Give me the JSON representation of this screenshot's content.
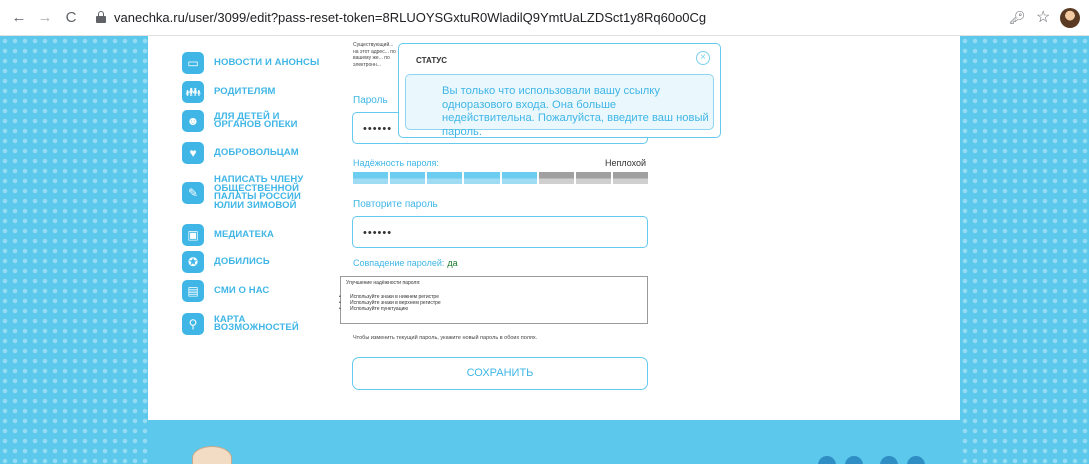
{
  "browser": {
    "url": "vanechka.ru/user/3099/edit?pass-reset-token=8RLUOYSGxtuR0WladilQ9YmtUaLZDSct1y8Rq60o0Cg",
    "icons": [
      "back-arrow-icon",
      "forward-arrow-icon",
      "reload-icon",
      "lock-icon",
      "key-icon",
      "star-icon"
    ]
  },
  "sidebar": {
    "items": [
      {
        "label": "НОВОСТИ И АНОНСЫ",
        "icon": "tv-icon"
      },
      {
        "label": "РОДИТЕЛЯМ",
        "icon": "family-icon"
      },
      {
        "label": "ДЛЯ ДЕТЕЙ И\nОРГАНОВ ОПЕКИ",
        "icon": "children-icon"
      },
      {
        "label": "ДОБРОВОЛЬЦАМ",
        "icon": "heart-icon"
      },
      {
        "label": "НАПИСАТЬ ЧЛЕНУ\nОБЩЕСТВЕННОЙ\nПАЛАТЫ РОССИИ\nЮЛИИ ЗИМОВОЙ",
        "icon": "pen-icon"
      },
      {
        "label": "МЕДИАТЕКА",
        "icon": "media-icon"
      },
      {
        "label": "ДОБИЛИСЬ",
        "icon": "award-icon"
      },
      {
        "label": "СМИ О НАС",
        "icon": "book-icon"
      },
      {
        "label": "КАРТА\nВОЗМОЖНОСТЕЙ",
        "icon": "map-pin-icon"
      }
    ]
  },
  "form": {
    "intro_text": "Существующий... на этот адрес... по вашему же... по электронн...",
    "password_label": "Пароль",
    "password_value": "••••••",
    "strength_label": "Надёжность пароля:",
    "strength_value": "Неплохой",
    "strength_fraction": 0.625,
    "confirm_label": "Повторите пароль",
    "confirm_value": "••••••",
    "match_label": "Совпадение паролей:",
    "match_value": "да",
    "tips_title": "Улучшение надёжности пароля:",
    "tips": [
      "Используйте знаки в нижнем регистре",
      "Используйте знаки в верхнем регистре",
      "Используйте пунктуацию"
    ],
    "hint": "Чтобы изменить текущий пароль, укажите новый пароль в обоих полях.",
    "save_label": "СОХРАНИТЬ"
  },
  "modal": {
    "title": "СТАТУС",
    "close_icon": "close-circle-icon",
    "message": "Вы только что использовали вашу ссылку одноразового входа. Она больше недействительна. Пожалуйста, введите ваш новый пароль."
  },
  "colors": {
    "brand_blue": "#3fb6e6",
    "page_bg": "#5cc8ec",
    "match_green": "#1d7a2a"
  }
}
